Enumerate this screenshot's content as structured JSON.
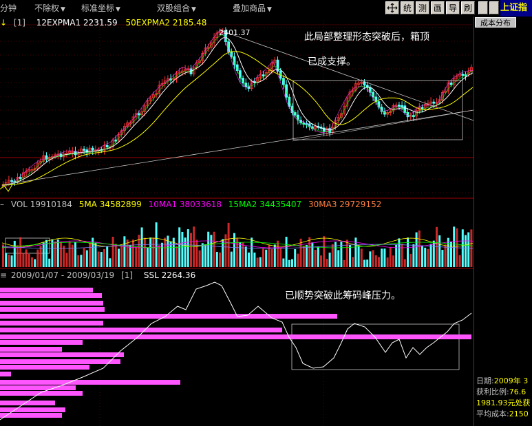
{
  "toolbar": {
    "items": [
      {
        "label": "分钟",
        "has_arrow": false
      },
      {
        "label": "不除权",
        "has_arrow": true
      },
      {
        "label": "标准坐标",
        "has_arrow": true
      },
      {
        "label": "双股组合",
        "has_arrow": true
      },
      {
        "label": "叠加商品",
        "has_arrow": true
      }
    ],
    "buttons": [
      "统",
      "测",
      "画",
      "导",
      "刷"
    ],
    "market_title": "上证指"
  },
  "main_chart": {
    "legend_bracket": "[1]",
    "legend_ma1": "12EXPMA1 2231.59",
    "legend_ma2": "50EXPMA2 2185.48",
    "peak_label": "2401.37",
    "annotation_line1": "此局部整理形态突破后，箱顶",
    "annotation_line2": "已成支撑。"
  },
  "volume_panel": {
    "vol": "VOL 19910184",
    "ma1": "5MA 34582899",
    "ma2": "10MA1 38033618",
    "ma3": "15MA2 34435407",
    "ma4": "30MA3 29729152"
  },
  "ssl_panel": {
    "range": "2009/01/07 - 2009/03/19",
    "bracket": "[1]",
    "ssl": "SSL 2264.36",
    "annotation": "已顺势突破此筹码峰压力。"
  },
  "right_panel": {
    "tab_label": "成本分布",
    "stats": [
      {
        "label": "日期:",
        "value": "2009年 3"
      },
      {
        "label": "获利比例:",
        "value": "76.6"
      },
      {
        "label": "",
        "value": "1981.93元处获"
      },
      {
        "label": "平均成本:",
        "value": "2150"
      }
    ]
  },
  "colors": {
    "up": "#ff3232",
    "down": "#54ffff",
    "ma_white": "#ffffff",
    "ma_yellow": "#ffff00",
    "ma_magenta": "#ff00ff",
    "ma_green": "#00ff00",
    "chip_bar": "#ff55ff",
    "chip_profile": "#ffff00"
  }
}
